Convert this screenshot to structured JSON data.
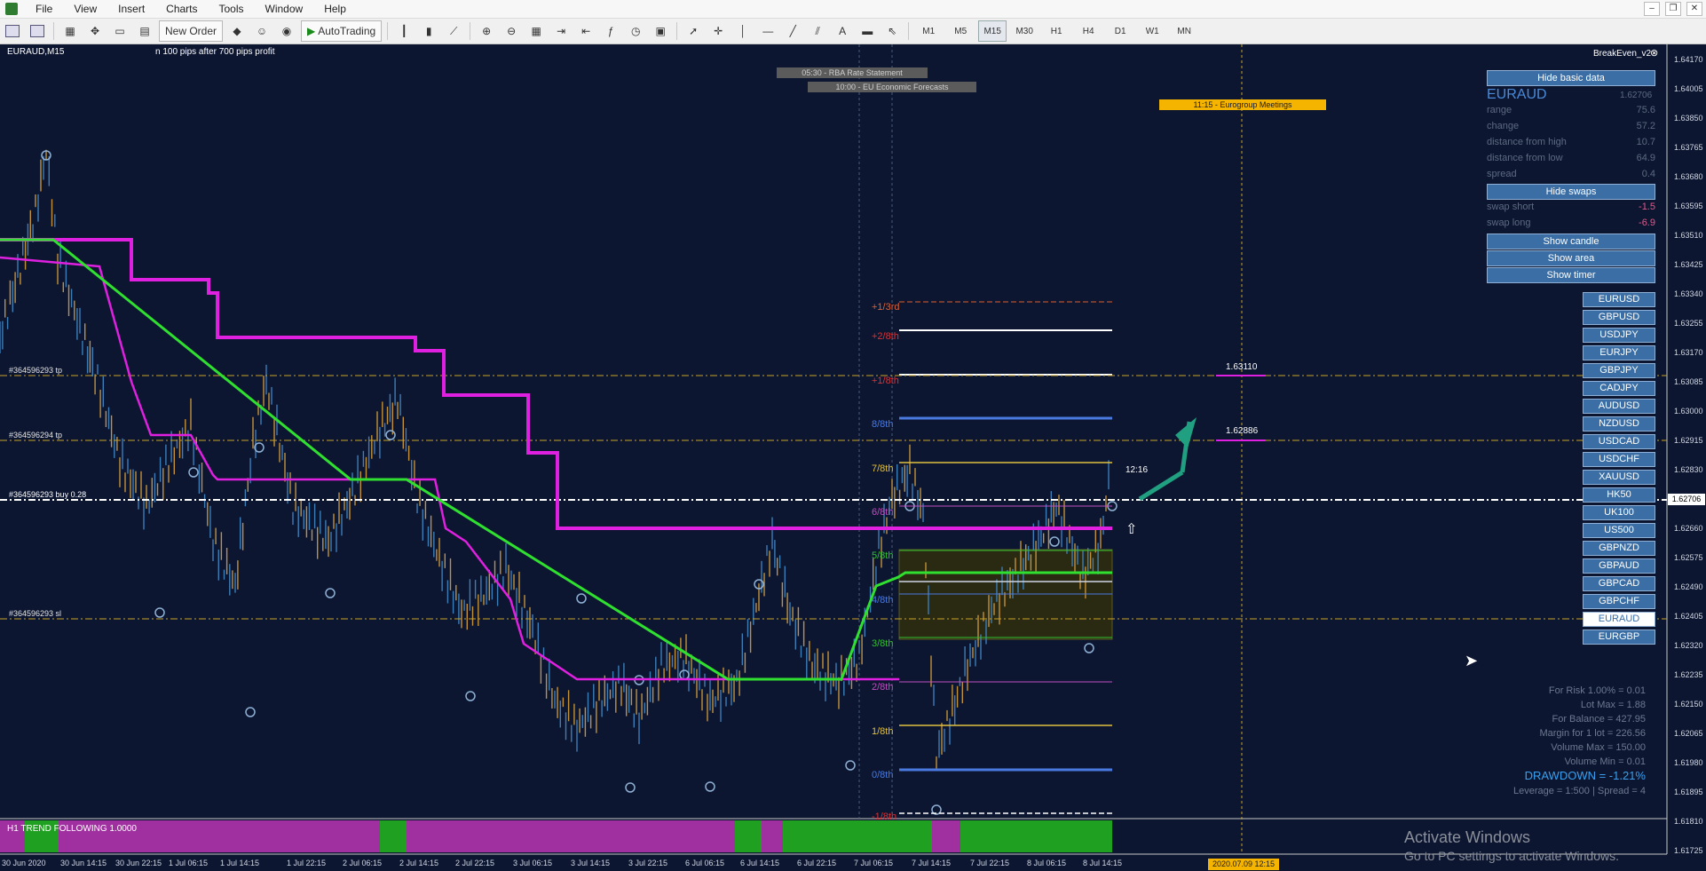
{
  "menu": [
    "File",
    "View",
    "Insert",
    "Charts",
    "Tools",
    "Window",
    "Help"
  ],
  "toolbar": {
    "new_order": "New Order",
    "autotrading": "AutoTrading",
    "timeframes": [
      "M1",
      "M5",
      "M15",
      "M30",
      "H1",
      "H4",
      "D1",
      "W1",
      "MN"
    ],
    "active_timeframe": "M15"
  },
  "chart": {
    "symbol_title": "EURAUD,M15",
    "comment": "n 100 pips after 700 pips profit",
    "indicator_name": "BreakEven_v2",
    "sub_indicator": "H1 TREND FOLLOWING 1.0000",
    "news": [
      "05:30 - RBA Rate Statement",
      "10:00 - EU Economic Forecasts",
      "11:15 - Eurogroup Meetings"
    ],
    "timer": "12:16",
    "crosshair_date": "2020.07.09 12:15"
  },
  "order_lines": {
    "tp1": "#364596293 tp",
    "tp2": "#364596294 tp",
    "buy": "#364596293 buy 0.28",
    "sl": "#364596293 sl"
  },
  "targets": {
    "t1": "1.63110",
    "t2": "1.62886"
  },
  "murrey": {
    "l0": "+1/3rd",
    "l1": "+2/8th",
    "l2": "+1/8th",
    "l3": "8/8th",
    "l4": "7/8th",
    "l5": "6/8th",
    "l6": "5/8th",
    "l7": "4/8th",
    "l8": "3/8th",
    "l9": "2/8th",
    "l10": "1/8th",
    "l11": "0/8th",
    "l12": "-1/8th"
  },
  "panel": {
    "hide_basic": "Hide basic data",
    "symbol": "EURAUD",
    "symbol_price": "1.62706",
    "rows": [
      {
        "label": "range",
        "value": "75.6"
      },
      {
        "label": "change",
        "value": "57.2"
      },
      {
        "label": "distance from high",
        "value": "10.7"
      },
      {
        "label": "distance from low",
        "value": "64.9"
      },
      {
        "label": "spread",
        "value": "0.4"
      }
    ],
    "hide_swaps": "Hide swaps",
    "swaps": [
      {
        "label": "swap short",
        "value": "-1.5"
      },
      {
        "label": "swap long",
        "value": "-6.9"
      }
    ],
    "show_candle": "Show candle",
    "show_area": "Show area",
    "show_timer": "Show timer",
    "symbols": [
      "EURUSD",
      "GBPUSD",
      "USDJPY",
      "EURJPY",
      "GBPJPY",
      "CADJPY",
      "AUDUSD",
      "NZDUSD",
      "USDCAD",
      "USDCHF",
      "XAUUSD",
      "HK50",
      "UK100",
      "US500",
      "GBPNZD",
      "GBPAUD",
      "GBPCAD",
      "GBPCHF",
      "EURAUD",
      "EURGBP"
    ],
    "selected_symbol": "EURAUD"
  },
  "account": {
    "for_risk": "For Risk 1.00% = 0.01",
    "lot_max": "Lot Max = 1.88",
    "for_balance": "For Balance = 427.95",
    "margin": "Margin for 1 lot = 226.56",
    "vol_max": "Volume Max = 150.00",
    "vol_min": "Volume Min = 0.01",
    "drawdown": "DRAWDOWN = -1.21%",
    "leverage": "Leverage = 1:500 | Spread = 4"
  },
  "y_axis": [
    "1.64170",
    "1.64005",
    "1.63850",
    "1.63765",
    "1.63680",
    "1.63595",
    "1.63510",
    "1.63425",
    "1.63340",
    "1.63255",
    "1.63170",
    "1.63085",
    "1.63000",
    "1.62915",
    "1.62830",
    "1.62745",
    "1.62660",
    "1.62575",
    "1.62490",
    "1.62405",
    "1.62320",
    "1.62235",
    "1.62150",
    "1.62065",
    "1.61980",
    "1.61895",
    "1.61810",
    "1.61725"
  ],
  "current_price": "1.62706",
  "x_axis": [
    "30 Jun 2020",
    "30 Jun 14:15",
    "30 Jun 22:15",
    "1 Jul 06:15",
    "1 Jul 14:15",
    "1 Jul 22:15",
    "2 Jul 06:15",
    "2 Jul 14:15",
    "2 Jul 22:15",
    "3 Jul 06:15",
    "3 Jul 14:15",
    "3 Jul 22:15",
    "6 Jul 06:15",
    "6 Jul 14:15",
    "6 Jul 22:15",
    "7 Jul 06:15",
    "7 Jul 14:15",
    "7 Jul 22:15",
    "8 Jul 06:15",
    "8 Jul 14:15"
  ],
  "watermark": {
    "line1": "Activate Windows",
    "line2": "Go to PC settings to activate Windows."
  },
  "colors": {
    "bg": "#0c1631",
    "magenta": "#e020e0",
    "green": "#30e030",
    "buy_line": "#ffffff",
    "level_line": "#c9a227",
    "arrow": "#20a080"
  }
}
